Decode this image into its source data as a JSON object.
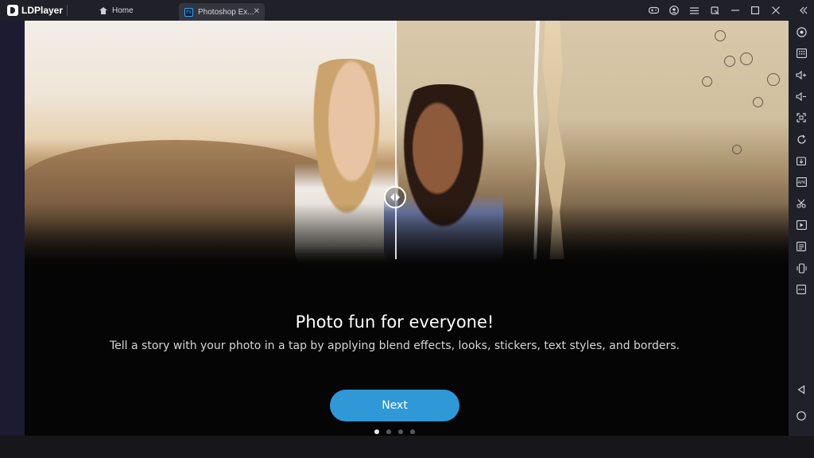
{
  "titlebar": {
    "app_name": "LDPlayer",
    "tabs": [
      {
        "label": "Home"
      },
      {
        "label": "Photoshop Ex...",
        "icon": "Ps"
      }
    ],
    "controls": [
      "gamepad-icon",
      "account-icon",
      "menu-icon",
      "pin-icon",
      "minimize-icon",
      "maximize-icon",
      "close-icon",
      "collapse-icon"
    ]
  },
  "hero": {
    "description_icons": [
      "compare-slider-icon"
    ]
  },
  "onboarding": {
    "headline": "Photo fun for everyone!",
    "subtext": "Tell a story with your photo in a tap by applying blend effects, looks, stickers, text styles, and borders.",
    "next_label": "Next",
    "page_count": 4,
    "current_page": 1
  },
  "sidebar": {
    "tools": [
      "settings-icon",
      "keyboard-mapping-icon",
      "volume-up-icon",
      "volume-down-icon",
      "fullscreen-icon",
      "rotate-icon",
      "install-apk-icon",
      "record-icon",
      "scissors-icon",
      "video-record-icon",
      "operation-record-icon",
      "shake-icon",
      "more-icon"
    ],
    "nav": [
      "back-icon",
      "home-icon"
    ]
  },
  "colors": {
    "accent": "#2f98d6",
    "titlebar_bg": "#202128",
    "app_bg": "#050505"
  }
}
